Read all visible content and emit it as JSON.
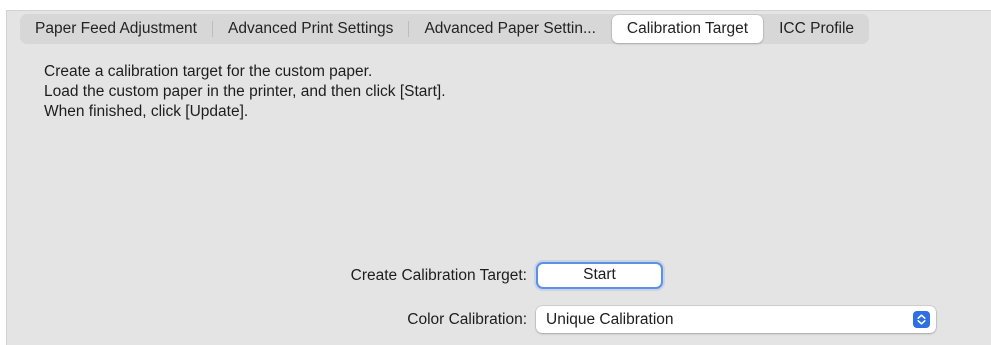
{
  "tabs": [
    {
      "label": "Paper Feed Adjustment",
      "selected": false
    },
    {
      "label": "Advanced Print Settings",
      "selected": false
    },
    {
      "label": "Advanced Paper Settin...",
      "selected": false
    },
    {
      "label": "Calibration Target",
      "selected": true
    },
    {
      "label": "ICC Profile",
      "selected": false
    }
  ],
  "instructions": [
    "Create a calibration target for the custom paper.",
    "Load the custom paper in the printer, and then click [Start].",
    "When finished, click [Update]."
  ],
  "create_target": {
    "label": "Create Calibration Target:",
    "button_label": "Start"
  },
  "color_calibration": {
    "label": "Color Calibration:",
    "selected_value": "Unique Calibration",
    "icon": "updown-chevron-icon"
  },
  "colors": {
    "panel_bg": "#e4e4e4",
    "accent": "#2f6fe4",
    "focus_ring": "#5b90e6"
  }
}
